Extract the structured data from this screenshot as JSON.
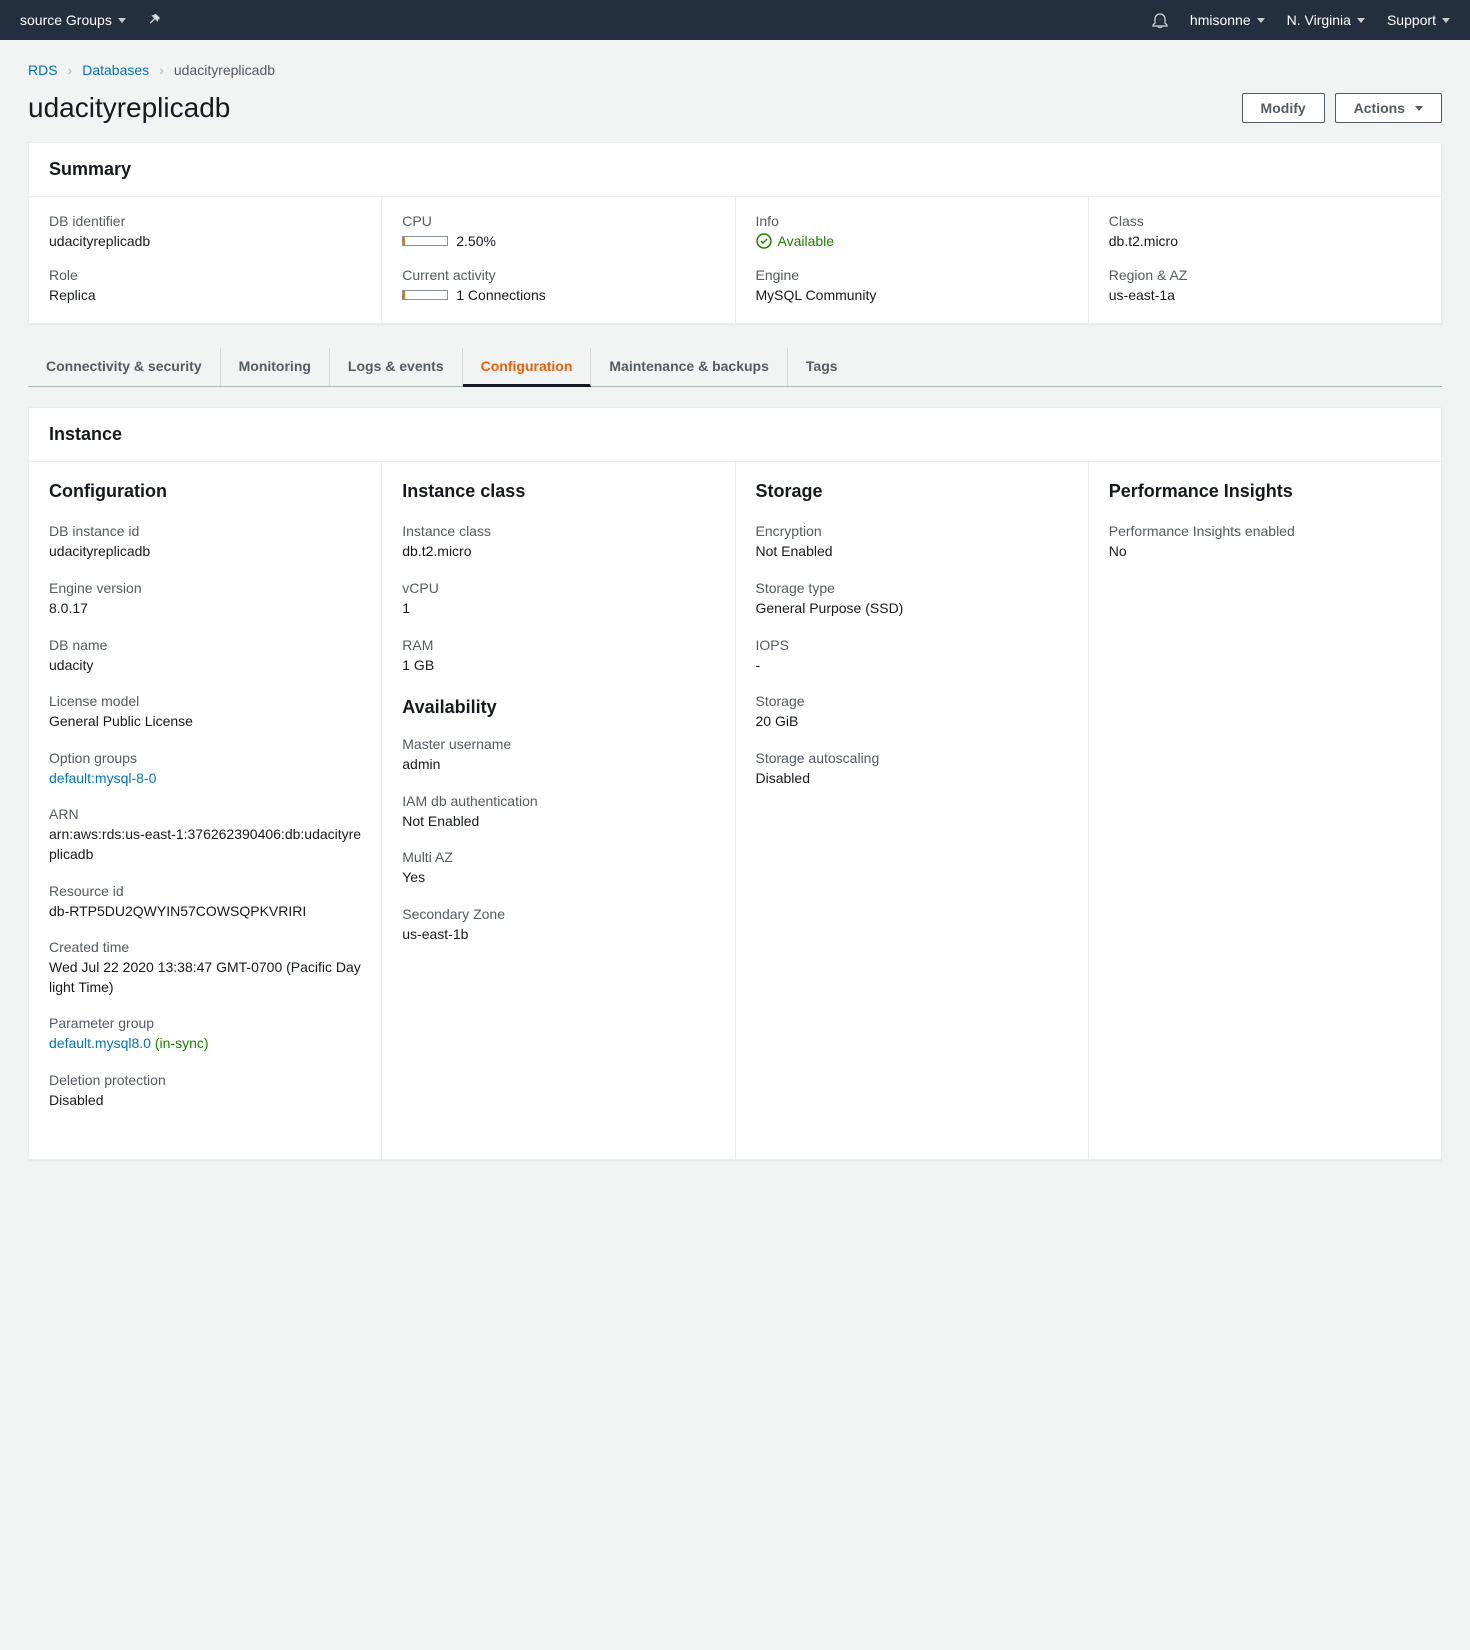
{
  "topbar": {
    "resource_groups": "source Groups",
    "user": "hmisonne",
    "region": "N. Virginia",
    "support": "Support"
  },
  "breadcrumb": {
    "root": "RDS",
    "databases": "Databases",
    "current": "udacityreplicadb"
  },
  "page": {
    "title": "udacityreplicadb",
    "modify_btn": "Modify",
    "actions_btn": "Actions"
  },
  "summary": {
    "heading": "Summary",
    "db_identifier_label": "DB identifier",
    "db_identifier": "udacityreplicadb",
    "role_label": "Role",
    "role": "Replica",
    "cpu_label": "CPU",
    "cpu": "2.50%",
    "activity_label": "Current activity",
    "activity": "1 Connections",
    "info_label": "Info",
    "info_status": "Available",
    "engine_label": "Engine",
    "engine": "MySQL Community",
    "class_label": "Class",
    "class": "db.t2.micro",
    "region_label": "Region & AZ",
    "region": "us-east-1a"
  },
  "tabs": {
    "connectivity": "Connectivity & security",
    "monitoring": "Monitoring",
    "logs": "Logs & events",
    "configuration": "Configuration",
    "maintenance": "Maintenance & backups",
    "tags": "Tags"
  },
  "instance": {
    "heading": "Instance",
    "configuration": {
      "title": "Configuration",
      "db_instance_id_label": "DB instance id",
      "db_instance_id": "udacityreplicadb",
      "engine_version_label": "Engine version",
      "engine_version": "8.0.17",
      "db_name_label": "DB name",
      "db_name": "udacity",
      "license_label": "License model",
      "license": "General Public License",
      "option_groups_label": "Option groups",
      "option_groups": "default:mysql-8-0",
      "arn_label": "ARN",
      "arn": "arn:aws:rds:us-east-1:376262390406:db:udacityreplicadb",
      "resource_id_label": "Resource id",
      "resource_id": "db-RTP5DU2QWYIN57COWSQPKVRIRI",
      "created_label": "Created time",
      "created": "Wed Jul 22 2020 13:38:47 GMT-0700 (Pacific Daylight Time)",
      "param_group_label": "Parameter group",
      "param_group": "default.mysql8.0",
      "param_group_status": "(in-sync)",
      "deletion_label": "Deletion protection",
      "deletion": "Disabled"
    },
    "instance_class": {
      "title": "Instance class",
      "class_label": "Instance class",
      "class": "db.t2.micro",
      "vcpu_label": "vCPU",
      "vcpu": "1",
      "ram_label": "RAM",
      "ram": "1 GB",
      "availability_heading": "Availability",
      "master_user_label": "Master username",
      "master_user": "admin",
      "iam_label": "IAM db authentication",
      "iam": "Not Enabled",
      "multi_az_label": "Multi AZ",
      "multi_az": "Yes",
      "secondary_label": "Secondary Zone",
      "secondary": "us-east-1b"
    },
    "storage": {
      "title": "Storage",
      "encryption_label": "Encryption",
      "encryption": "Not Enabled",
      "type_label": "Storage type",
      "type": "General Purpose (SSD)",
      "iops_label": "IOPS",
      "iops": "-",
      "storage_label": "Storage",
      "storage": "20 GiB",
      "autoscale_label": "Storage autoscaling",
      "autoscale": "Disabled"
    },
    "perf": {
      "title": "Performance Insights",
      "enabled_label": "Performance Insights enabled",
      "enabled": "No"
    }
  }
}
